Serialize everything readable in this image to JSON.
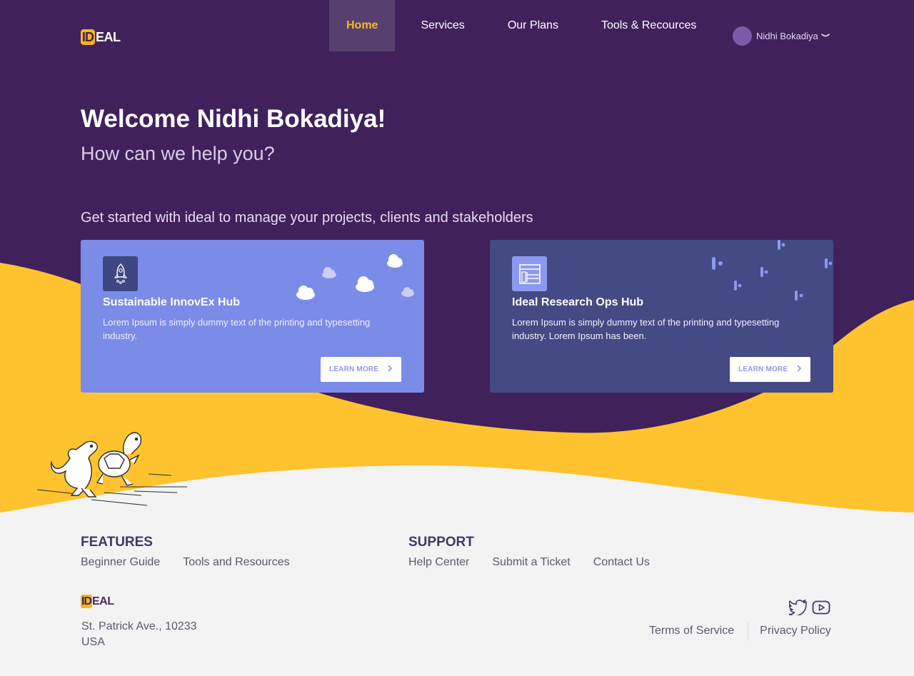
{
  "brand": {
    "logo_id": "ID",
    "logo_rest": "EAL"
  },
  "nav": {
    "items": [
      {
        "label": "Home",
        "active": true
      },
      {
        "label": "Services",
        "active": false
      },
      {
        "label": "Our Plans",
        "active": false
      },
      {
        "label": "Tools & Recources",
        "active": false
      }
    ]
  },
  "user": {
    "name": "Nidhi Bokadiya"
  },
  "hero": {
    "welcome": "Welcome Nidhi Bokadiya!",
    "help": "How can we help you?",
    "get_started": "Get started with ideal to manage your projects, clients and stakeholders"
  },
  "cards": [
    {
      "title": "Sustainable InnovEx Hub",
      "description": "Lorem Ipsum is simply dummy text of the printing and typesetting industry.",
      "button": "LEARN MORE",
      "icon": "rocket-icon"
    },
    {
      "title": "Ideal Research Ops Hub",
      "description": "Lorem Ipsum is simply dummy text of the printing and typesetting industry. Lorem Ipsum has been.",
      "button": "LEARN MORE",
      "icon": "layout-icon"
    }
  ],
  "footer": {
    "features": {
      "heading": "FEATURES",
      "links": [
        "Beginner Guide",
        "Tools and Resources"
      ]
    },
    "support": {
      "heading": "SUPPORT",
      "links": [
        "Help Center",
        "Submit a Ticket",
        "Contact Us"
      ]
    },
    "address_line1": "St. Patrick Ave., 10233",
    "address_line2": "USA",
    "legal": [
      "Terms of Service",
      "Privacy Policy"
    ],
    "socials": [
      "twitter-icon",
      "youtube-icon"
    ]
  },
  "colors": {
    "hero_bg": "#40215c",
    "accent_yellow": "#fec32e",
    "card_one": "#7b8be8",
    "card_two": "#434a84",
    "footer_bg": "#f3f3f3"
  }
}
